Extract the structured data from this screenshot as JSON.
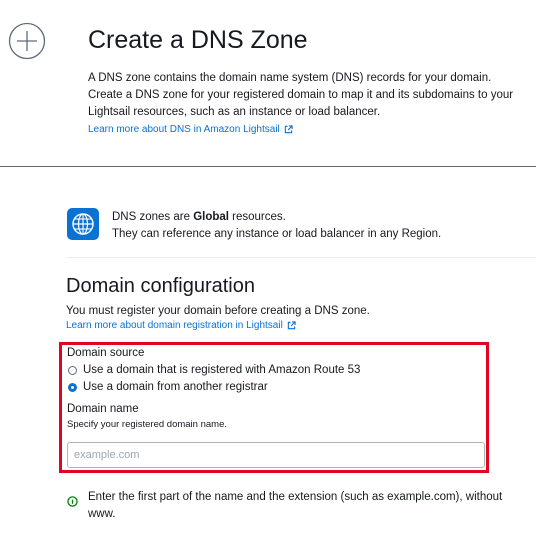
{
  "header": {
    "title": "Create a DNS Zone",
    "description": "A DNS zone contains the domain name system (DNS) records for your domain. Create a DNS zone for your registered domain to map it and its subdomains to your Lightsail resources, such as an instance or load balancer.",
    "learn_more_link": "Learn more about DNS in Amazon Lightsail"
  },
  "info_banner": {
    "line1_prefix": "DNS zones are ",
    "line1_strong": "Global",
    "line1_suffix": " resources.",
    "line2": "They can reference any instance or load balancer in any Region."
  },
  "domain_config": {
    "heading": "Domain configuration",
    "description": "You must register your domain before creating a DNS zone.",
    "learn_more_link": "Learn more about domain registration in Lightsail",
    "source_label": "Domain source",
    "options": [
      {
        "label": "Use a domain that is registered with Amazon Route 53",
        "selected": false
      },
      {
        "label": "Use a domain from another registrar",
        "selected": true
      }
    ],
    "name_label": "Domain name",
    "name_hint": "Specify your registered domain name.",
    "name_placeholder": "example.com",
    "name_value": "",
    "help_text": "Enter the first part of the name and the extension (such as example.com), without www."
  },
  "colors": {
    "accent": "#0972d3",
    "highlight_border": "#e0061f",
    "success": "#037f0c"
  },
  "icons": [
    "add-plus-icon",
    "external-link-icon",
    "globe-icon",
    "check-circle-icon"
  ]
}
